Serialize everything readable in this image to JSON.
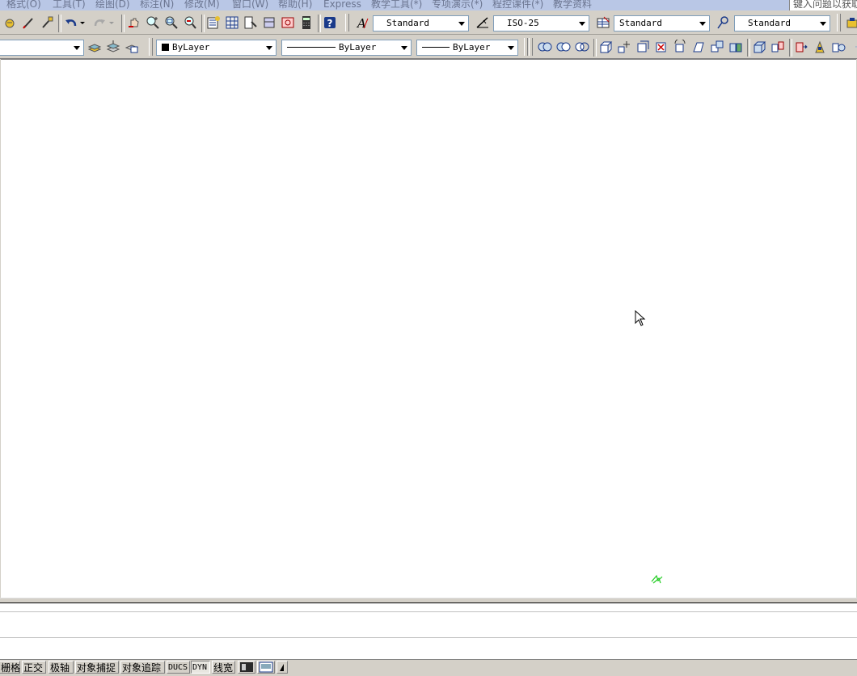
{
  "menubar": {
    "items": [
      "格式(O)",
      "工具(T)",
      "绘图(D)",
      "标注(N)",
      "修改(M)",
      "窗口(W)",
      "帮助(H)",
      "Express",
      "教学工具(*)",
      "专项演示(*)",
      "程控课件(*)",
      "教学资料"
    ],
    "help_search": "键入问题以获取帮助"
  },
  "styles_toolbar": {
    "text_style": "Standard",
    "dim_style": "ISO-25",
    "table_style": "Standard",
    "multileader_style": "Standard"
  },
  "properties_toolbar": {
    "layer": "",
    "color": "ByLayer",
    "linetype": "ByLayer",
    "lineweight": "ByLayer"
  },
  "statusbar": {
    "buttons": [
      "栅格",
      "正交",
      "极轴",
      "对象捕捉",
      "对象追踪",
      "DUCS",
      "DYN",
      "线宽"
    ]
  },
  "colors": {
    "ucs_icon": "#22cc22",
    "menubar_bg": "#b9c7e6",
    "chrome_bg": "#d4d0c8"
  }
}
